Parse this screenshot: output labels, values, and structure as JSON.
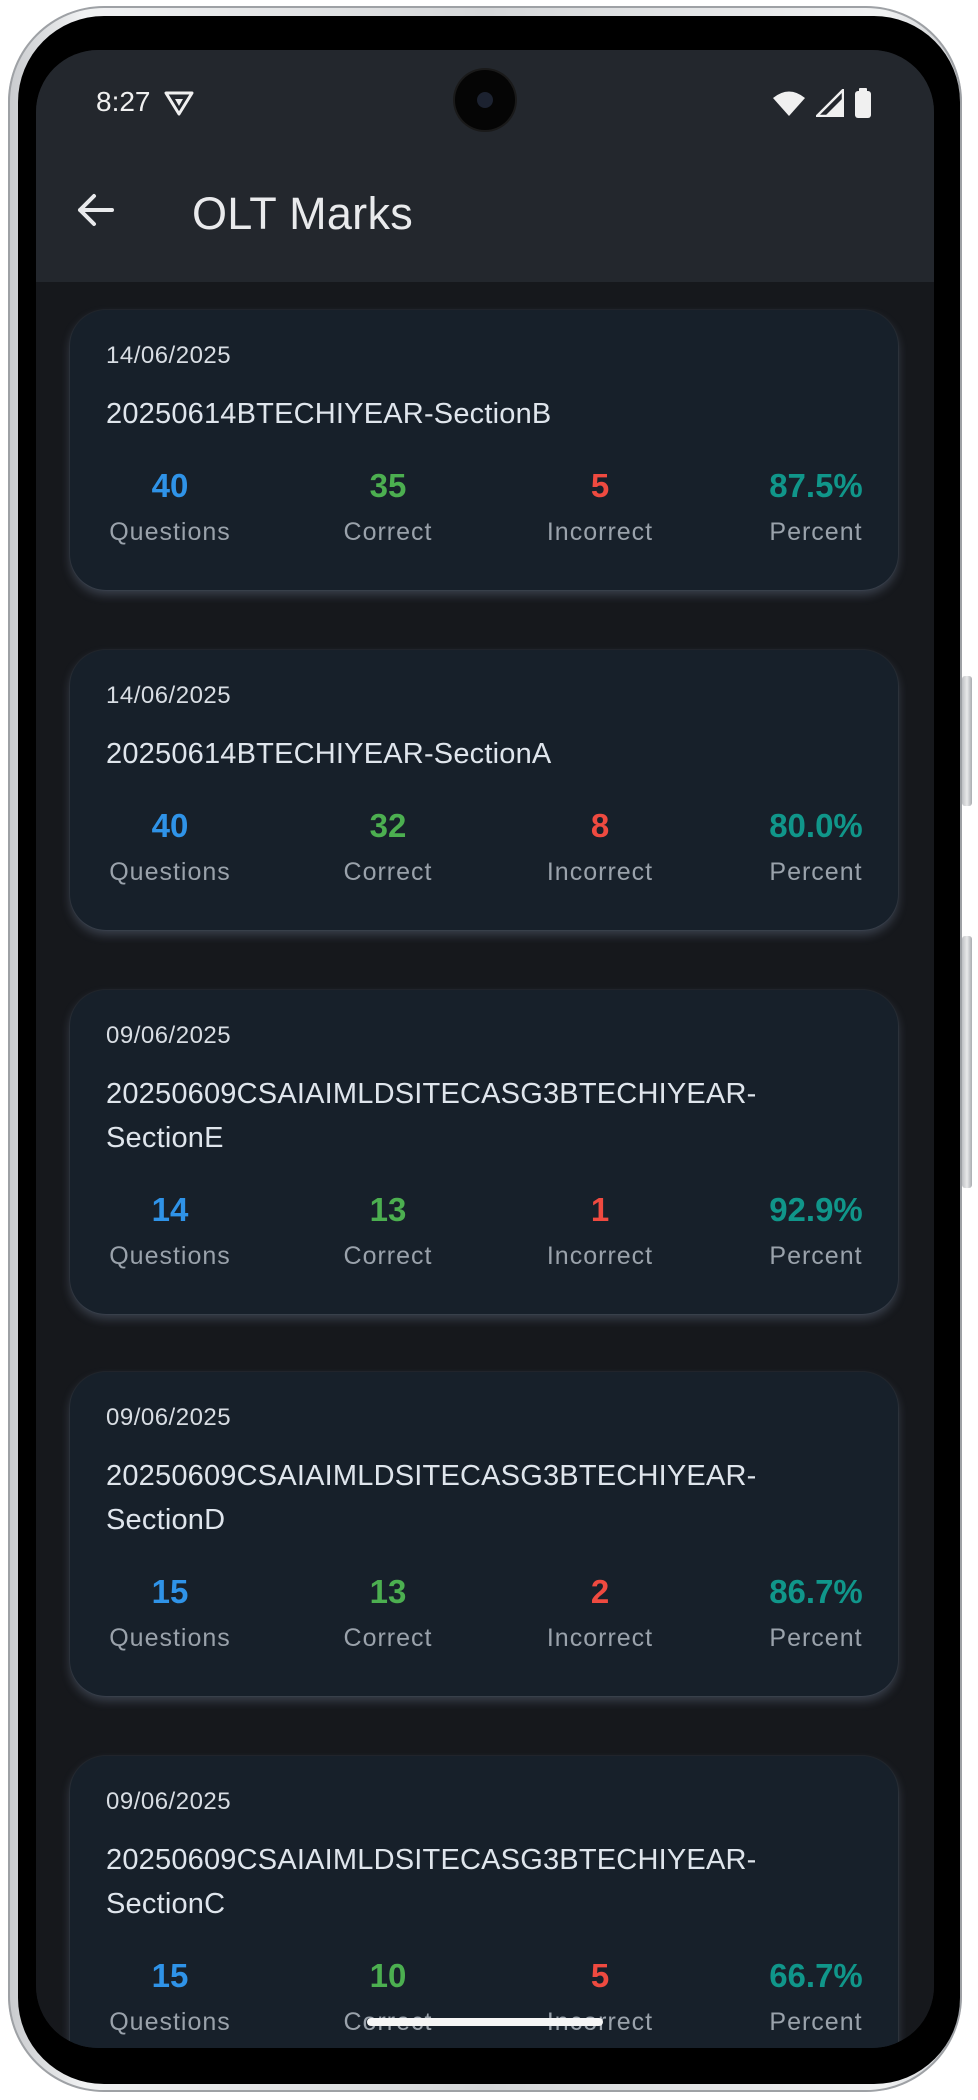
{
  "status_bar": {
    "time": "8:27",
    "vpn_icon": "vpn-shield-icon",
    "wifi_icon": "wifi-icon",
    "signal_icon": "signal-icon",
    "battery_icon": "battery-icon"
  },
  "app_bar": {
    "title": "OLT Marks",
    "back_icon": "arrow-back-icon"
  },
  "colors": {
    "questions": "#2f93e8",
    "correct": "#4caf50",
    "incorrect": "#ef4a40",
    "percent": "#10968a",
    "card_bg": "#17202a",
    "app_bar_bg": "#23272d"
  },
  "labels": {
    "questions": "Questions",
    "correct": "Correct",
    "incorrect": "Incorrect",
    "percent": "Percent"
  },
  "cards": [
    {
      "date": "14/06/2025",
      "name": "20250614BTECHIYEAR-SectionB",
      "questions": "40",
      "correct": "35",
      "incorrect": "5",
      "percent": "87.5%"
    },
    {
      "date": "14/06/2025",
      "name": "20250614BTECHIYEAR-SectionA",
      "questions": "40",
      "correct": "32",
      "incorrect": "8",
      "percent": "80.0%"
    },
    {
      "date": "09/06/2025",
      "name": "20250609CSAIAIMLDSITECASG3BTECHIYEAR-SectionE",
      "questions": "14",
      "correct": "13",
      "incorrect": "1",
      "percent": "92.9%"
    },
    {
      "date": "09/06/2025",
      "name": "20250609CSAIAIMLDSITECASG3BTECHIYEAR-SectionD",
      "questions": "15",
      "correct": "13",
      "incorrect": "2",
      "percent": "86.7%"
    },
    {
      "date": "09/06/2025",
      "name": "20250609CSAIAIMLDSITECASG3BTECHIYEAR-SectionC",
      "questions": "15",
      "correct": "10",
      "incorrect": "5",
      "percent": "66.7%"
    }
  ]
}
